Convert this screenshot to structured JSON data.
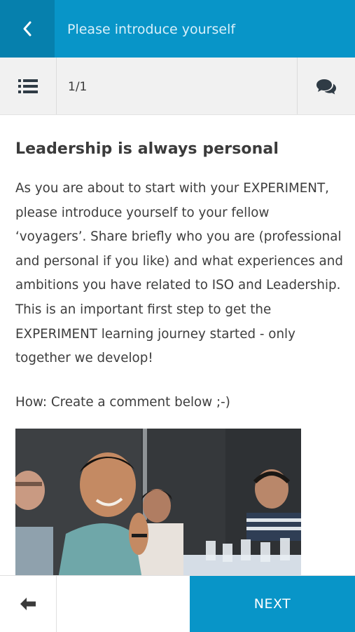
{
  "header": {
    "title": "Please introduce yourself",
    "back_icon": "chevron-left-icon"
  },
  "toolbar": {
    "list_icon": "list-icon",
    "page_counter": "1/1",
    "chat_icon": "comments-icon"
  },
  "content": {
    "heading": "Leadership is always personal",
    "body": "As you are about to start with your EXPERIMENT, please introduce yourself to your fellow ‘voyagers’. Share briefly who you are (professional and personal if you like) and what experiences and ambitions you have related to ISO and Leadership. This is an important first step to get the EXPERIMENT learning journey started - only together we develop!",
    "howto": "How: Create a comment below ;-)"
  },
  "footer": {
    "prev_icon": "arrow-left-icon",
    "next_label": "NEXT"
  },
  "colors": {
    "brand": "#0895c8",
    "brand_dark": "#0680ad",
    "toolbar_bg": "#f1f1f1"
  }
}
